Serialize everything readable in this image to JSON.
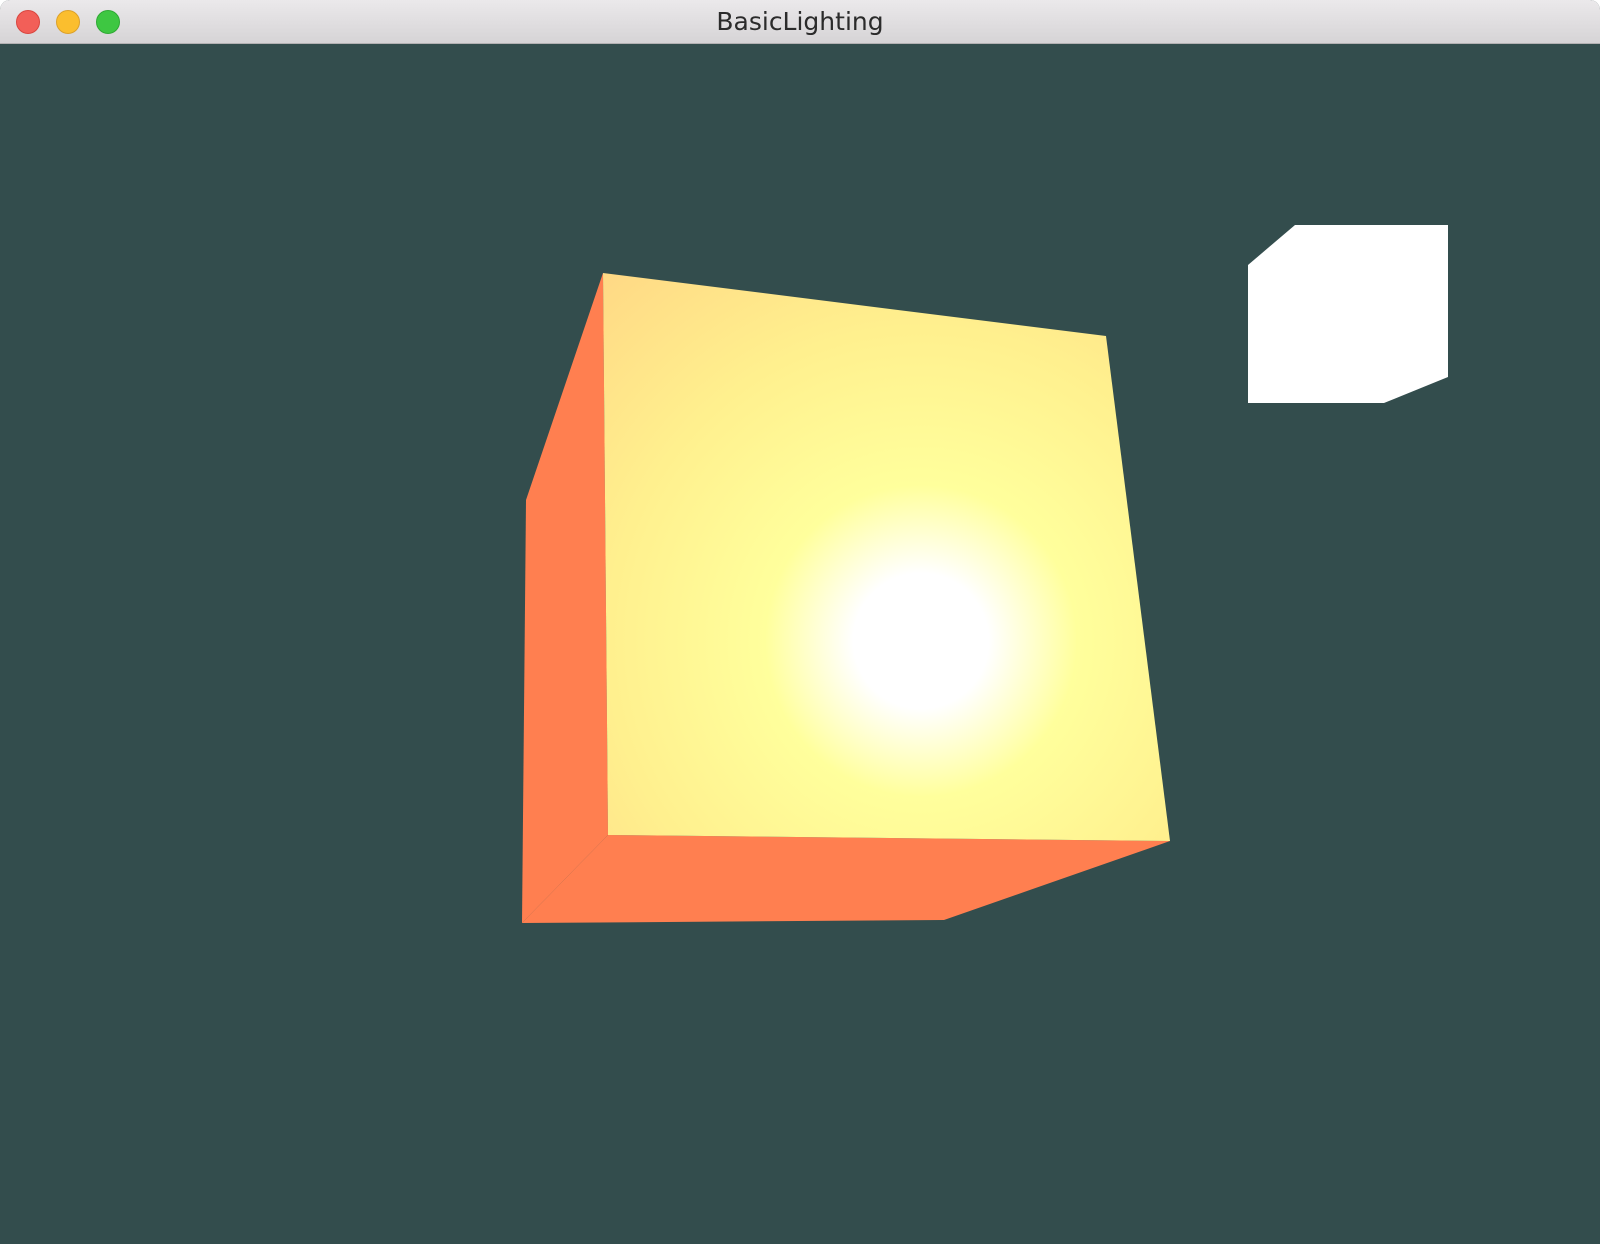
{
  "window": {
    "title": "BasicLighting"
  },
  "traffic_lights": {
    "close": "close-button",
    "minimize": "minimize-button",
    "zoom": "zoom-button"
  },
  "scene": {
    "background_color": "#334d4d",
    "object_color": "#ff7f50",
    "light_color": "#ffffff",
    "lit_face_color": "#fff694"
  }
}
